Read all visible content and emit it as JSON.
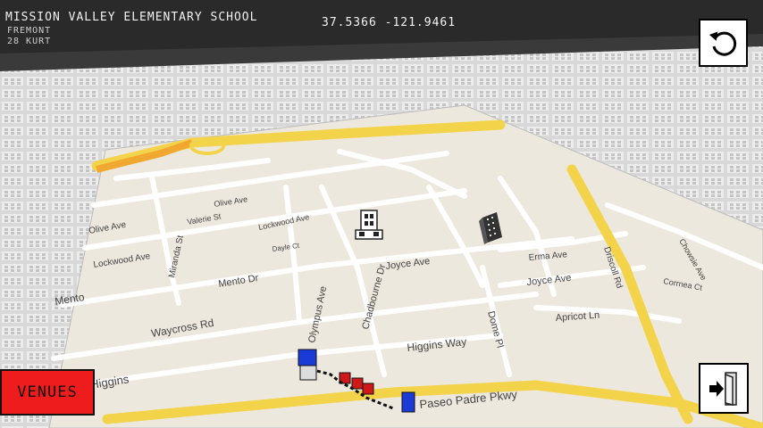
{
  "hud": {
    "venue_name": "MISSION VALLEY ELEMENTARY SCHOOL",
    "coordinates": "37.5366 -121.9461",
    "city": "FREMONT",
    "zip": "28 KURT"
  },
  "buttons": {
    "venues_label": "VENUES",
    "back_icon": "rotate-back-icon",
    "exit_icon": "exit-door-icon"
  },
  "map": {
    "streets": {
      "mento": "Mento",
      "mento_dr": "Mento Dr",
      "olive_ave_left": "Olive Ave",
      "olive_ave": "Olive Ave",
      "lockwood_ave": "Lockwood Ave",
      "lockwood_ave_2": "Lockwood Ave",
      "valerie_st": "Valerie St",
      "miranda_st": "Miranda St",
      "dayle_ct": "Dayle Ct",
      "joyce_ave": "Joyce Ave",
      "joyce_ave_2": "Joyce Ave",
      "waycross_rd": "Waycross Rd",
      "olympus_ave": "Olympus Ave",
      "chadbourne_dr": "Chadbourne Dr",
      "higgins_way": "Higgins Way",
      "higgins": "Higgins",
      "dome_pl": "Dome Pl",
      "paseo_padre": "Paseo Padre Pkwy",
      "apricot_ln": "Apricot Ln",
      "erma_ave": "Erma Ave",
      "driscoll_rd": "Driscoll Rd",
      "corrnea_ct": "Corrnea Ct",
      "chowsie_ave": "Chowsie Ave"
    }
  }
}
